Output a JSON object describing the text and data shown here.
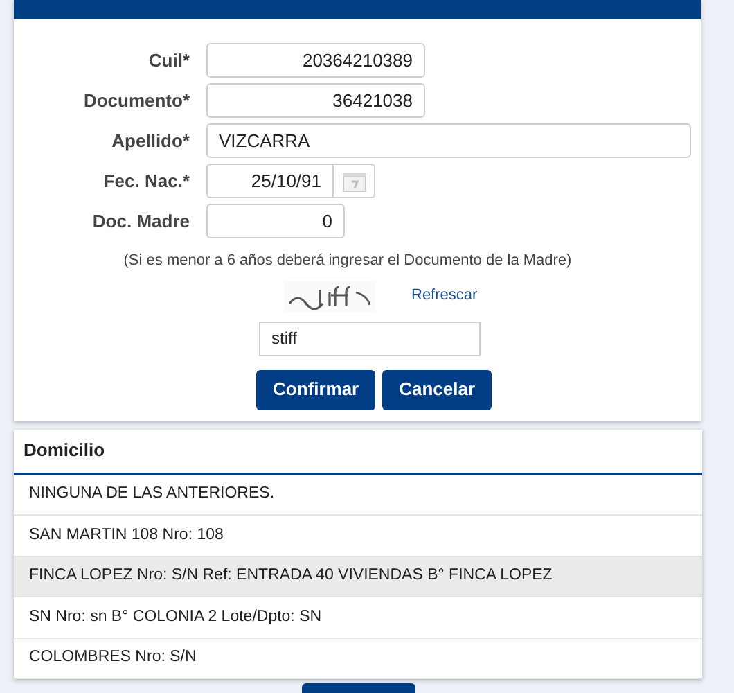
{
  "form": {
    "fields": [
      {
        "label": "Cuil*",
        "value": "20364210389",
        "kind": "number"
      },
      {
        "label": "Documento*",
        "value": "36421038",
        "kind": "number"
      },
      {
        "label": "Apellido*",
        "value": "VIZCARRA",
        "kind": "text"
      },
      {
        "label": "Fec. Nac.*",
        "value": "25/10/91",
        "kind": "date"
      },
      {
        "label": "Doc. Madre",
        "value": "0",
        "kind": "short"
      }
    ],
    "hint": "(Si es menor a 6 años deberá ingresar el Documento de la Madre)",
    "captcha": {
      "refresh_link": "Refrescar",
      "value": "stiff"
    },
    "buttons": [
      "Confirmar",
      "Cancelar"
    ]
  },
  "domicilio": {
    "title": "Domicilio",
    "rows": [
      {
        "text": "NINGUNA DE LAS ANTERIORES.",
        "selected": false
      },
      {
        "text": "SAN MARTIN 108 Nro: 108",
        "selected": false
      },
      {
        "text": "FINCA LOPEZ Nro: S/N Ref: ENTRADA 40 VIVIENDAS B° FINCA LOPEZ",
        "selected": true
      },
      {
        "text": "SN Nro: sn B° COLONIA 2 Lote/Dpto: SN",
        "selected": false
      },
      {
        "text": "COLOMBRES Nro: S/N",
        "selected": false
      }
    ]
  }
}
